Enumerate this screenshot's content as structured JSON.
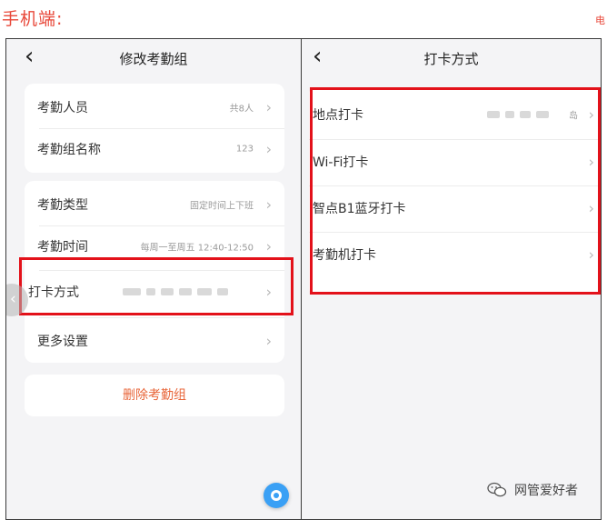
{
  "caption": "手机端:",
  "caption_right": "电",
  "left_screen": {
    "title": "修改考勤组",
    "back_icon": "‹",
    "card1": [
      {
        "label": "考勤人员",
        "value": "共8人"
      },
      {
        "label": "考勤组名称",
        "value": "123"
      }
    ],
    "card2": [
      {
        "label": "考勤类型",
        "value": "固定时间上下班"
      },
      {
        "label": "考勤时间",
        "value": "每周一至周五 12:40-12:50"
      },
      {
        "label": "打卡方式",
        "value": ""
      },
      {
        "label": "更多设置",
        "value": ""
      }
    ],
    "delete_label": "删除考勤组"
  },
  "right_screen": {
    "title": "打卡方式",
    "back_icon": "‹",
    "items": [
      {
        "label": "地点打卡",
        "value": "岛"
      },
      {
        "label": "Wi-Fi打卡",
        "value": ""
      },
      {
        "label": "智点B1蓝牙打卡",
        "value": ""
      },
      {
        "label": "考勤机打卡",
        "value": ""
      }
    ]
  },
  "watermark": "网管爱好者",
  "colors": {
    "highlight": "#e3111a",
    "delete_text": "#e8663a",
    "page_bg": "#f4f4f6",
    "caption": "#e8483a"
  }
}
